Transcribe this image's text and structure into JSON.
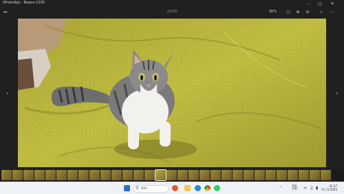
{
  "window": {
    "title": "WhatsApp - Видео 2295",
    "minimize_icon": "minimize-icon",
    "maximize_icon": "maximize-icon",
    "close_icon": "close-icon"
  },
  "toolbar": {
    "counter": "22/30",
    "zoom": "90%",
    "icons": [
      "back-arrow-icon",
      "fit-window-icon",
      "zoom-in-icon",
      "zoom-out-icon",
      "rotate-icon",
      "delete-icon",
      "favorite-icon",
      "share-icon",
      "more-icon"
    ]
  },
  "viewer": {
    "prev_icon": "chevron-left-icon",
    "next_icon": "chevron-right-icon"
  },
  "taskbar": {
    "search_placeholder": "Ask",
    "language_top": "ТУК",
    "language_bottom": "ТУЯ",
    "time": "22:37",
    "date": "11.11.2025"
  },
  "colors": {
    "blanket": "#b5b33a",
    "background": "#202020",
    "taskbar": "#eef1f6"
  }
}
